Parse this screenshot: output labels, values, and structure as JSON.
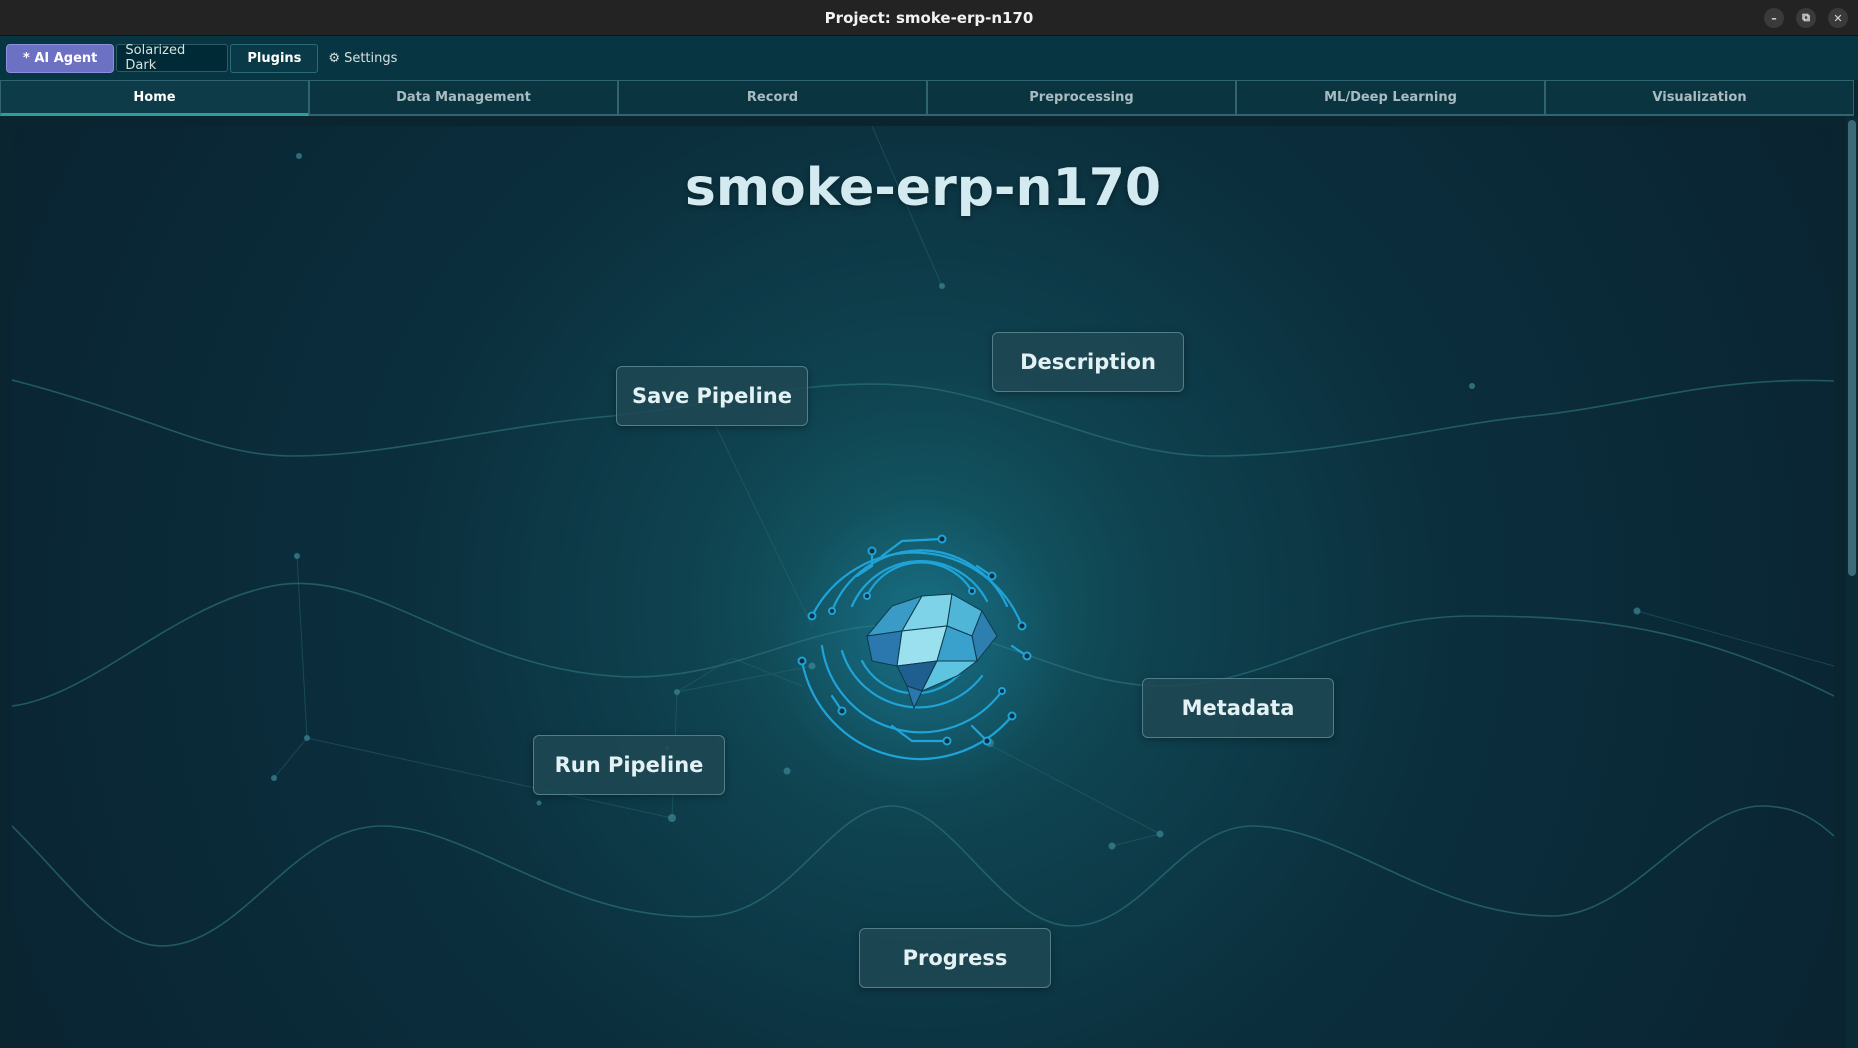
{
  "window": {
    "title": "Project: smoke-erp-n170",
    "controls": [
      "–",
      "⧉",
      "✕"
    ]
  },
  "toolbar": {
    "ai_agent_label": "* AI Agent",
    "theme_value": "Solarized Dark",
    "plugins_label": "Plugins",
    "settings_label": "Settings",
    "settings_icon": "gear-icon"
  },
  "tabs": [
    {
      "label": "Home",
      "active": true
    },
    {
      "label": "Data Management",
      "active": false
    },
    {
      "label": "Record",
      "active": false
    },
    {
      "label": "Preprocessing",
      "active": false
    },
    {
      "label": "ML/Deep Learning",
      "active": false
    },
    {
      "label": "Visualization",
      "active": false
    }
  ],
  "home": {
    "project_name": "smoke-erp-n170",
    "buttons": {
      "save_pipeline": "Save Pipeline",
      "description": "Description",
      "metadata": "Metadata",
      "run_pipeline": "Run Pipeline",
      "progress": "Progress"
    },
    "center_icon": "brain-circuit-icon"
  },
  "colors": {
    "accent": "#6c71c4",
    "tab_active_underline": "#2aa198",
    "circuit": "#1fa3d8",
    "background": "#0b2f3d"
  }
}
